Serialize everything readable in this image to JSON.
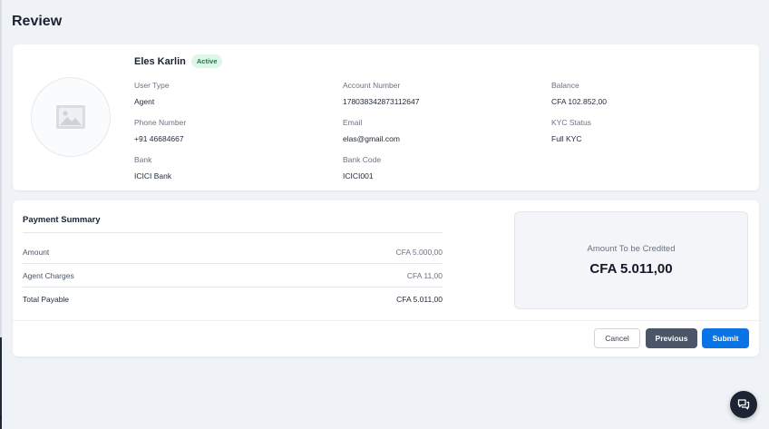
{
  "page": {
    "title": "Review"
  },
  "profile": {
    "name": "Eles Karlin",
    "status": "Active",
    "fields": {
      "user_type": {
        "label": "User Type",
        "value": "Agent"
      },
      "account_number": {
        "label": "Account Number",
        "value": "178038342873112647"
      },
      "balance": {
        "label": "Balance",
        "value": "CFA 102.852,00"
      },
      "phone_number": {
        "label": "Phone Number",
        "value": "+91 46684667"
      },
      "email": {
        "label": "Email",
        "value": "elas@gmail.com"
      },
      "kyc_status": {
        "label": "KYC Status",
        "value": "Full KYC"
      },
      "bank": {
        "label": "Bank",
        "value": "ICICI Bank"
      },
      "bank_code": {
        "label": "Bank Code",
        "value": "ICICI001"
      }
    },
    "avatar_icon": "image-placeholder-icon"
  },
  "payment_summary": {
    "title": "Payment Summary",
    "rows": [
      {
        "label": "Amount",
        "value": "CFA 5.000,00"
      },
      {
        "label": "Agent Charges",
        "value": "CFA 11,00"
      },
      {
        "label": "Total Payable",
        "value": "CFA 5.011,00"
      }
    ],
    "credited": {
      "label": "Amount To be Credited",
      "value": "CFA 5.011,00"
    }
  },
  "actions": {
    "cancel": "Cancel",
    "previous": "Previous",
    "submit": "Submit"
  },
  "colors": {
    "primary": "#0b74e5",
    "secondary": "#4b5567",
    "badge_bg": "#dff5e8",
    "badge_text": "#1f7a4b",
    "background": "#eff2f7"
  },
  "chat": {
    "icon": "chat-bubbles-icon"
  }
}
